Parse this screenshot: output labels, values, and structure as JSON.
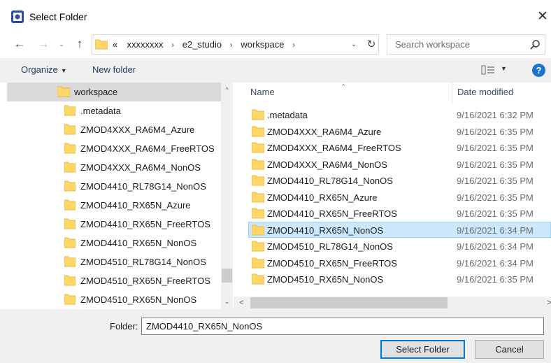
{
  "window": {
    "title": "Select Folder",
    "close_glyph": "✕"
  },
  "nav": {
    "back_glyph": "←",
    "forward_glyph": "→",
    "recent_glyph": "⌄",
    "up_glyph": "↑",
    "breadcrumbs": [
      "xxxxxxxx",
      "e2_studio",
      "workspace"
    ],
    "overflow_glyph": "«",
    "separator_glyph": "›",
    "address_dropdown_glyph": "⌄",
    "refresh_glyph": "↻"
  },
  "search": {
    "placeholder": "Search workspace"
  },
  "toolbar": {
    "organize_label": "Organize",
    "organize_caret": "▼",
    "new_folder_label": "New folder",
    "view_dropdown_glyph": "▼",
    "help_label": "?"
  },
  "tree": {
    "items": [
      {
        "label": "workspace",
        "selected": true
      },
      {
        "label": ".metadata"
      },
      {
        "label": "ZMOD4XXX_RA6M4_Azure"
      },
      {
        "label": "ZMOD4XXX_RA6M4_FreeRTOS"
      },
      {
        "label": "ZMOD4XXX_RA6M4_NonOS"
      },
      {
        "label": "ZMOD4410_RL78G14_NonOS"
      },
      {
        "label": "ZMOD4410_RX65N_Azure"
      },
      {
        "label": "ZMOD4410_RX65N_FreeRTOS"
      },
      {
        "label": "ZMOD4410_RX65N_NonOS"
      },
      {
        "label": "ZMOD4510_RL78G14_NonOS"
      },
      {
        "label": "ZMOD4510_RX65N_FreeRTOS"
      },
      {
        "label": "ZMOD4510_RX65N_NonOS"
      }
    ]
  },
  "list": {
    "columns": {
      "name": "Name",
      "date_modified": "Date modified"
    },
    "sort_glyph": "^",
    "rows": [
      {
        "name": ".metadata",
        "date": "9/16/2021 6:32 PM"
      },
      {
        "name": "ZMOD4XXX_RA6M4_Azure",
        "date": "9/16/2021 6:35 PM"
      },
      {
        "name": "ZMOD4XXX_RA6M4_FreeRTOS",
        "date": "9/16/2021 6:35 PM"
      },
      {
        "name": "ZMOD4XXX_RA6M4_NonOS",
        "date": "9/16/2021 6:35 PM"
      },
      {
        "name": "ZMOD4410_RL78G14_NonOS",
        "date": "9/16/2021 6:35 PM"
      },
      {
        "name": "ZMOD4410_RX65N_Azure",
        "date": "9/16/2021 6:35 PM"
      },
      {
        "name": "ZMOD4410_RX65N_FreeRTOS",
        "date": "9/16/2021 6:35 PM"
      },
      {
        "name": "ZMOD4410_RX65N_NonOS",
        "date": "9/16/2021 6:34 PM",
        "selected": true
      },
      {
        "name": "ZMOD4510_RL78G14_NonOS",
        "date": "9/16/2021 6:34 PM"
      },
      {
        "name": "ZMOD4510_RX65N_FreeRTOS",
        "date": "9/16/2021 6:34 PM"
      },
      {
        "name": "ZMOD4510_RX65N_NonOS",
        "date": "9/16/2021 6:35 PM"
      }
    ]
  },
  "scroll": {
    "up_glyph": "^",
    "down_glyph": "⌄",
    "left_glyph": "<",
    "right_glyph": ">"
  },
  "footer": {
    "folder_label": "Folder:",
    "folder_value": "ZMOD4410_RX65N_NonOS",
    "select_button": "Select Folder",
    "cancel_button": "Cancel"
  },
  "colors": {
    "folder_yellow": "#ffd766",
    "folder_dark": "#e8b84a",
    "selection_blue": "#cce8ff",
    "accent_blue": "#0078d7",
    "help_blue": "#1a74d2"
  }
}
